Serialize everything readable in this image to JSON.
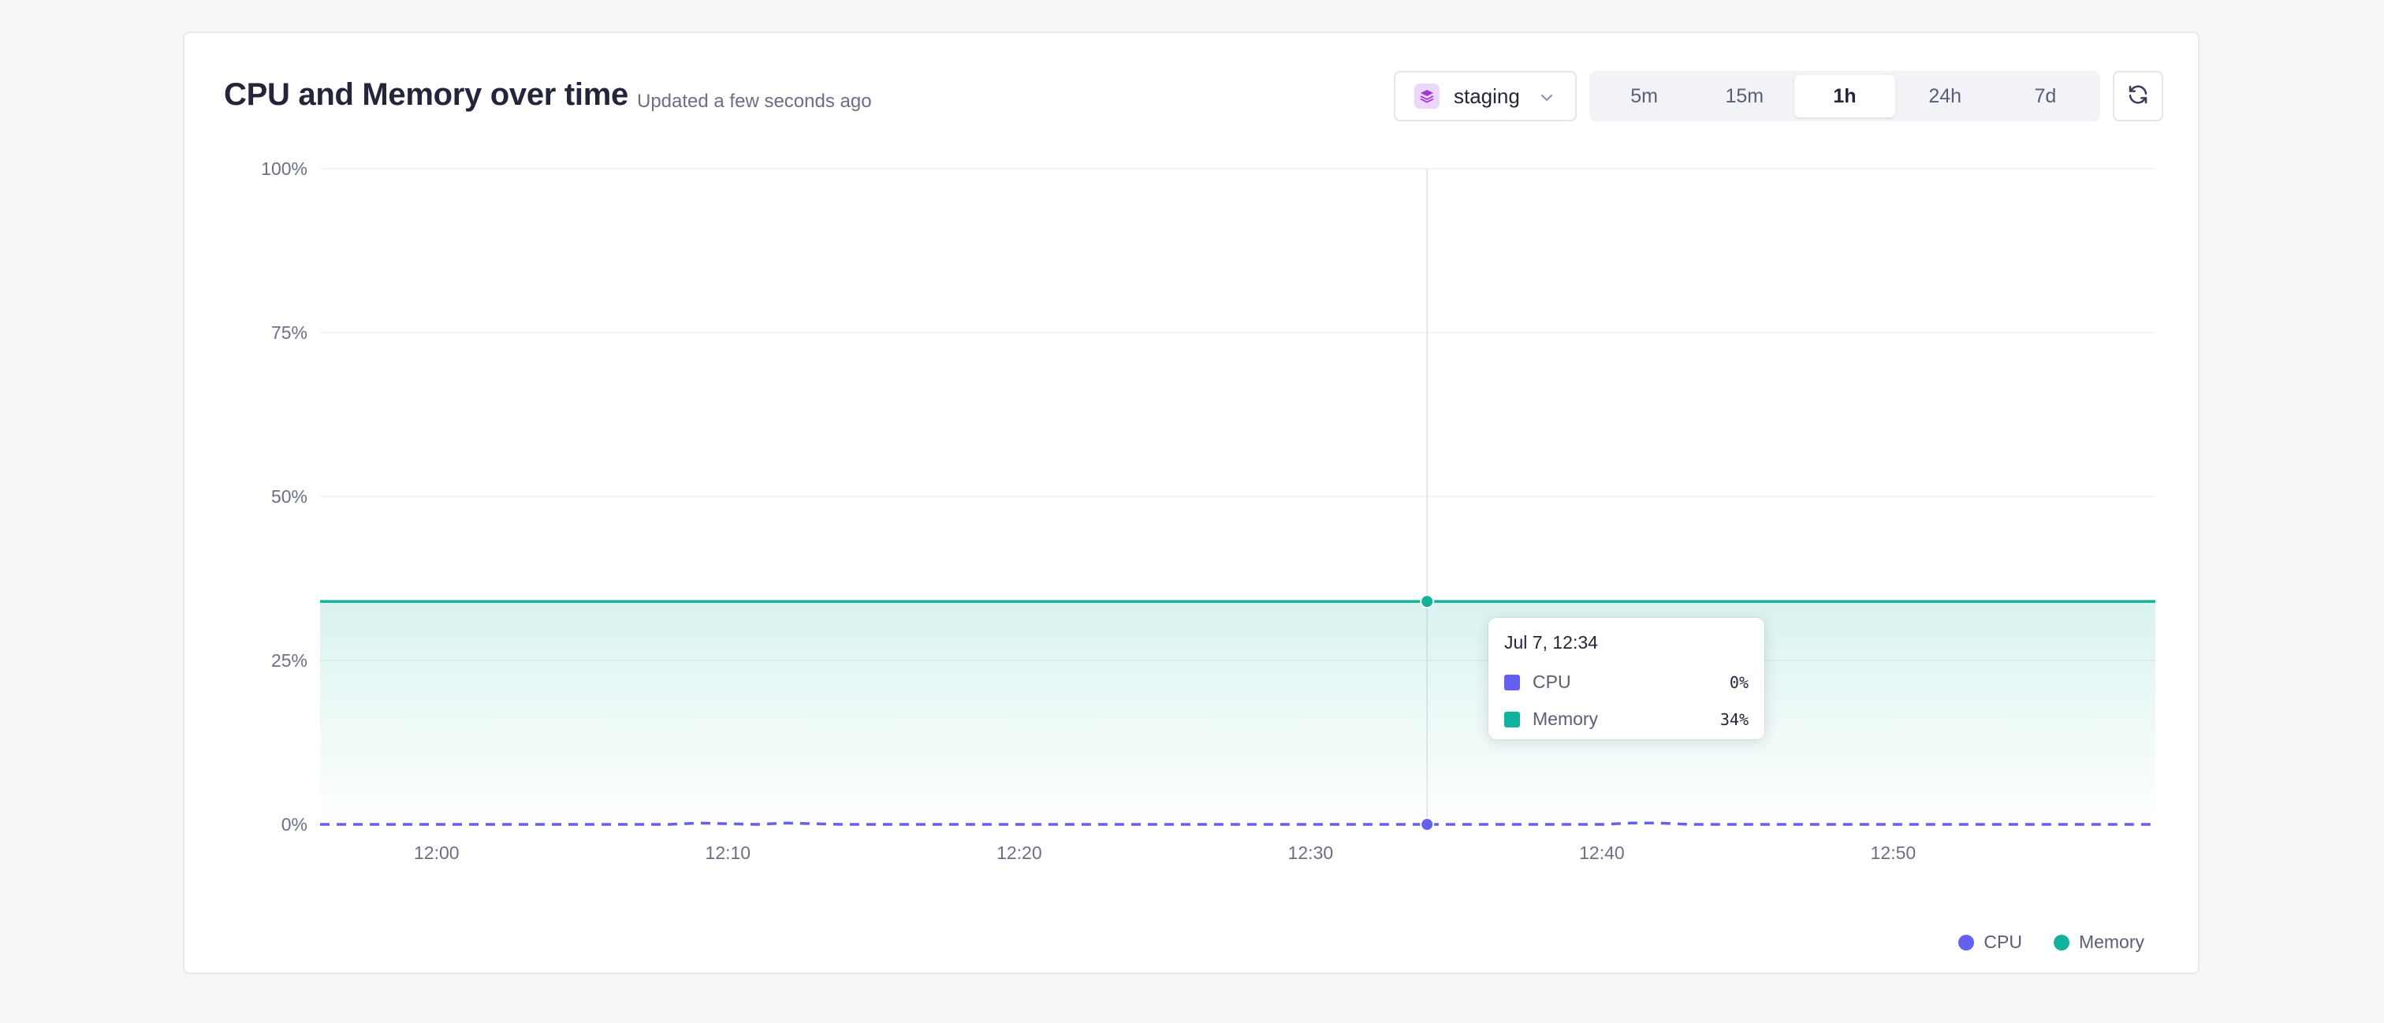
{
  "header": {
    "title": "CPU and Memory over time",
    "subtitle": "Updated a few seconds ago"
  },
  "environment": {
    "label": "staging",
    "icon": "layers-icon",
    "badge_color": "#ead7fb"
  },
  "time_ranges": [
    {
      "label": "5m",
      "active": false
    },
    {
      "label": "15m",
      "active": false
    },
    {
      "label": "1h",
      "active": true
    },
    {
      "label": "24h",
      "active": false
    },
    {
      "label": "7d",
      "active": false
    }
  ],
  "refresh": {
    "icon": "refresh-icon"
  },
  "tooltip": {
    "title": "Jul 7, 12:34",
    "rows": [
      {
        "name": "CPU",
        "value": "0%",
        "color": "#6461f1"
      },
      {
        "name": "Memory",
        "value": "34%",
        "color": "#12b39c"
      }
    ]
  },
  "legend": [
    {
      "name": "CPU",
      "color": "#6461f1"
    },
    {
      "name": "Memory",
      "color": "#12b39c"
    }
  ],
  "chart_data": {
    "type": "area",
    "x_ticks": [
      "12:00",
      "12:10",
      "12:20",
      "12:30",
      "12:40",
      "12:50"
    ],
    "y_ticks": [
      "100%",
      "75%",
      "50%",
      "25%",
      "0%"
    ],
    "ylim": [
      0,
      100
    ],
    "xlim_minutes": [
      -4,
      59
    ],
    "x_tick_minutes": [
      0,
      10,
      20,
      30,
      40,
      50
    ],
    "grid": true,
    "legend_position": "bottom-right",
    "hover_minute": 34,
    "series": [
      {
        "name": "Memory",
        "style": "solid-area",
        "color": "#12b39c",
        "x_minutes": [
          -4,
          0,
          10,
          20,
          30,
          34,
          40,
          50,
          59
        ],
        "values": [
          34,
          34,
          34,
          34,
          34,
          34,
          34,
          34,
          34
        ]
      },
      {
        "name": "CPU",
        "style": "dashed",
        "color": "#6461f1",
        "x_minutes": [
          -4,
          8,
          9,
          10,
          11,
          12,
          13,
          14,
          20,
          30,
          34,
          40,
          41,
          42,
          43,
          50,
          59
        ],
        "values": [
          0,
          0,
          0.2,
          0.1,
          0,
          0.2,
          0.1,
          0,
          0,
          0,
          0,
          0,
          0.2,
          0.2,
          0,
          0,
          0
        ]
      }
    ]
  }
}
